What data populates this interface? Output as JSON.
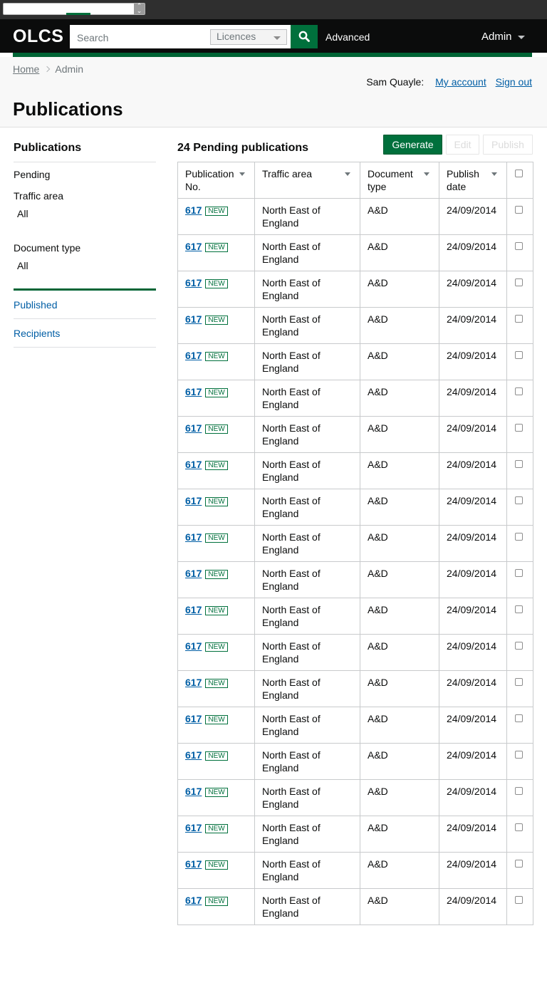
{
  "header": {
    "logo": "OLCS",
    "search_placeholder": "Search",
    "search_scope": "Licences",
    "advanced_label": "Advanced",
    "admin_menu_label": "Admin"
  },
  "breadcrumb": {
    "home": "Home",
    "current": "Admin"
  },
  "user": {
    "name": "Sam Quayle:",
    "my_account": "My account",
    "sign_out": "Sign out"
  },
  "page": {
    "title": "Publications"
  },
  "sidebar": {
    "title": "Publications",
    "pending": "Pending",
    "traffic_area_label": "Traffic area",
    "traffic_area_value": "All",
    "document_type_label": "Document type",
    "document_type_value": "All",
    "links": [
      "Published",
      "Recipients"
    ]
  },
  "main": {
    "count_title": "24 Pending publications",
    "buttons": {
      "generate": "Generate",
      "edit": "Edit",
      "publish": "Publish"
    }
  },
  "table": {
    "columns": [
      "Publication No.",
      "Traffic area",
      "Document type",
      "Publish date"
    ],
    "new_tag": "NEW",
    "rows": [
      {
        "no": "617",
        "area": "North East of England",
        "doc": "A&D",
        "date": "24/09/2014"
      },
      {
        "no": "617",
        "area": "North East of England",
        "doc": "A&D",
        "date": "24/09/2014"
      },
      {
        "no": "617",
        "area": "North East of England",
        "doc": "A&D",
        "date": "24/09/2014"
      },
      {
        "no": "617",
        "area": "North East of England",
        "doc": "A&D",
        "date": "24/09/2014"
      },
      {
        "no": "617",
        "area": "North East of England",
        "doc": "A&D",
        "date": "24/09/2014"
      },
      {
        "no": "617",
        "area": "North East of England",
        "doc": "A&D",
        "date": "24/09/2014"
      },
      {
        "no": "617",
        "area": "North East of England",
        "doc": "A&D",
        "date": "24/09/2014"
      },
      {
        "no": "617",
        "area": "North East of England",
        "doc": "A&D",
        "date": "24/09/2014"
      },
      {
        "no": "617",
        "area": "North East of England",
        "doc": "A&D",
        "date": "24/09/2014"
      },
      {
        "no": "617",
        "area": "North East of England",
        "doc": "A&D",
        "date": "24/09/2014"
      },
      {
        "no": "617",
        "area": "North East of England",
        "doc": "A&D",
        "date": "24/09/2014"
      },
      {
        "no": "617",
        "area": "North East of England",
        "doc": "A&D",
        "date": "24/09/2014"
      },
      {
        "no": "617",
        "area": "North East of England",
        "doc": "A&D",
        "date": "24/09/2014"
      },
      {
        "no": "617",
        "area": "North East of England",
        "doc": "A&D",
        "date": "24/09/2014"
      },
      {
        "no": "617",
        "area": "North East of England",
        "doc": "A&D",
        "date": "24/09/2014"
      },
      {
        "no": "617",
        "area": "North East of England",
        "doc": "A&D",
        "date": "24/09/2014"
      },
      {
        "no": "617",
        "area": "North East of England",
        "doc": "A&D",
        "date": "24/09/2014"
      },
      {
        "no": "617",
        "area": "North East of England",
        "doc": "A&D",
        "date": "24/09/2014"
      },
      {
        "no": "617",
        "area": "North East of England",
        "doc": "A&D",
        "date": "24/09/2014"
      },
      {
        "no": "617",
        "area": "North East of England",
        "doc": "A&D",
        "date": "24/09/2014"
      }
    ]
  },
  "colors": {
    "brand_green": "#00703c",
    "link_blue": "#005ea5",
    "header_black": "#0b0c0c"
  }
}
